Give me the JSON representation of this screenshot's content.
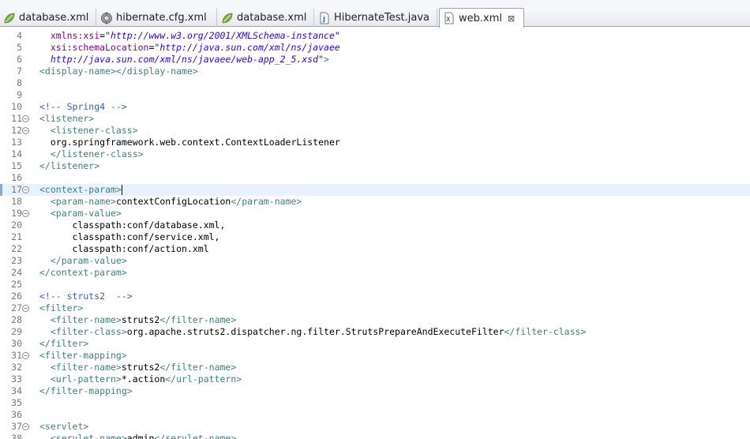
{
  "tabs": [
    {
      "label": "database.xml",
      "icon": "spring-leaf-icon",
      "active": false
    },
    {
      "label": "hibernate.cfg.xml",
      "icon": "hibernate-config-icon",
      "active": false
    },
    {
      "label": "database.xml",
      "icon": "spring-leaf-icon",
      "active": false
    },
    {
      "label": "HibernateTest.java",
      "icon": "java-file-icon",
      "active": false
    },
    {
      "label": "web.xml",
      "icon": "xml-file-icon",
      "active": true
    }
  ],
  "close_glyph": "⊠",
  "colors": {
    "tag": "#3f7f7f",
    "attr": "#7f007f",
    "value": "#2a00ff",
    "comment": "#3f5fbf",
    "current_line": "#e8f2fe"
  },
  "lines": [
    {
      "n": "4",
      "fold": false,
      "segs": [
        [
          "t",
          "  "
        ],
        [
          "a",
          "xmlns:xsi"
        ],
        [
          "t",
          "="
        ],
        [
          "v",
          "\"http://www.w3.org/2001/XMLSchema-instance\""
        ]
      ]
    },
    {
      "n": "5",
      "fold": false,
      "segs": [
        [
          "t",
          "  "
        ],
        [
          "a",
          "xsi:schemaLocation"
        ],
        [
          "t",
          "="
        ],
        [
          "v",
          "\"http://java.sun.com/xml/ns/javaee"
        ]
      ]
    },
    {
      "n": "6",
      "fold": false,
      "segs": [
        [
          "v",
          "  http://java.sun.com/xml/ns/javaee/web-app_2_5.xsd\""
        ],
        [
          "g",
          ">"
        ]
      ]
    },
    {
      "n": "7",
      "fold": false,
      "segs": [
        [
          "g",
          "<display-name></display-name>"
        ]
      ]
    },
    {
      "n": "8",
      "fold": false,
      "segs": []
    },
    {
      "n": "9",
      "fold": false,
      "segs": []
    },
    {
      "n": "10",
      "fold": false,
      "segs": [
        [
          "c",
          "<!-- Spring4 -->"
        ]
      ]
    },
    {
      "n": "11",
      "fold": true,
      "segs": [
        [
          "g",
          "<listener>"
        ]
      ]
    },
    {
      "n": "12",
      "fold": true,
      "segs": [
        [
          "g",
          "  <listener-class>"
        ]
      ]
    },
    {
      "n": "13",
      "fold": false,
      "segs": [
        [
          "t",
          "  org.springframework.web.context.ContextLoaderListener"
        ]
      ]
    },
    {
      "n": "14",
      "fold": false,
      "segs": [
        [
          "g",
          "  </listener-class>"
        ]
      ]
    },
    {
      "n": "15",
      "fold": false,
      "segs": [
        [
          "g",
          "</listener>"
        ]
      ]
    },
    {
      "n": "16",
      "fold": false,
      "segs": []
    },
    {
      "n": "17",
      "fold": true,
      "current": true,
      "segs": [
        [
          "g",
          "<context-param>"
        ]
      ]
    },
    {
      "n": "18",
      "fold": false,
      "segs": [
        [
          "g",
          "  <param-name>"
        ],
        [
          "t",
          "contextConfigLocation"
        ],
        [
          "g",
          "</param-name>"
        ]
      ]
    },
    {
      "n": "19",
      "fold": true,
      "segs": [
        [
          "g",
          "  <param-value>"
        ]
      ]
    },
    {
      "n": "20",
      "fold": false,
      "segs": [
        [
          "t",
          "      classpath:conf/database.xml,"
        ]
      ]
    },
    {
      "n": "21",
      "fold": false,
      "segs": [
        [
          "t",
          "      classpath:conf/service.xml,"
        ]
      ]
    },
    {
      "n": "22",
      "fold": false,
      "segs": [
        [
          "t",
          "      classpath:conf/action.xml"
        ]
      ]
    },
    {
      "n": "23",
      "fold": false,
      "segs": [
        [
          "g",
          "  </param-value>"
        ]
      ]
    },
    {
      "n": "24",
      "fold": false,
      "segs": [
        [
          "g",
          "</context-param>"
        ]
      ]
    },
    {
      "n": "25",
      "fold": false,
      "segs": []
    },
    {
      "n": "26",
      "fold": false,
      "segs": [
        [
          "c",
          "<!-- struts2  -->"
        ]
      ]
    },
    {
      "n": "27",
      "fold": true,
      "segs": [
        [
          "g",
          "<filter>"
        ]
      ]
    },
    {
      "n": "28",
      "fold": false,
      "segs": [
        [
          "g",
          "  <filter-name>"
        ],
        [
          "t",
          "struts2"
        ],
        [
          "g",
          "</filter-name>"
        ]
      ]
    },
    {
      "n": "29",
      "fold": false,
      "segs": [
        [
          "g",
          "  <filter-class>"
        ],
        [
          "t",
          "org.apache.struts2.dispatcher.ng.filter.StrutsPrepareAndExecuteFilter"
        ],
        [
          "g",
          "</filter-class>"
        ]
      ]
    },
    {
      "n": "30",
      "fold": false,
      "segs": [
        [
          "g",
          "</filter>"
        ]
      ]
    },
    {
      "n": "31",
      "fold": true,
      "segs": [
        [
          "g",
          "<filter-mapping>"
        ]
      ]
    },
    {
      "n": "32",
      "fold": false,
      "segs": [
        [
          "g",
          "  <filter-name>"
        ],
        [
          "t",
          "struts2"
        ],
        [
          "g",
          "</filter-name>"
        ]
      ]
    },
    {
      "n": "33",
      "fold": false,
      "segs": [
        [
          "g",
          "  <url-pattern>"
        ],
        [
          "t",
          "*.action"
        ],
        [
          "g",
          "</url-pattern>"
        ]
      ]
    },
    {
      "n": "34",
      "fold": false,
      "segs": [
        [
          "g",
          "</filter-mapping>"
        ]
      ]
    },
    {
      "n": "35",
      "fold": false,
      "segs": []
    },
    {
      "n": "36",
      "fold": false,
      "segs": []
    },
    {
      "n": "37",
      "fold": true,
      "segs": [
        [
          "g",
          "<servlet>"
        ]
      ]
    },
    {
      "n": "38",
      "fold": false,
      "segs": [
        [
          "g",
          "  <servlet-name>"
        ],
        [
          "t",
          "admin"
        ],
        [
          "g",
          "</servlet-name>"
        ]
      ]
    }
  ]
}
